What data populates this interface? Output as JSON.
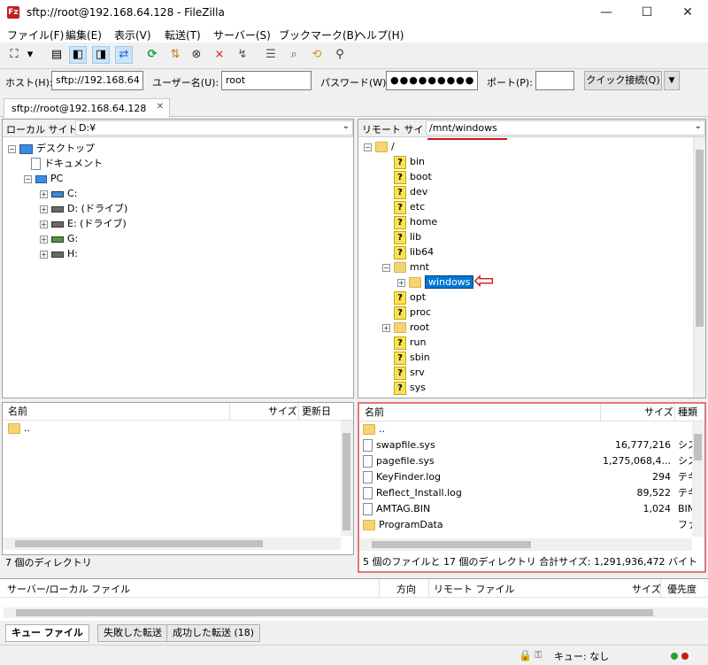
{
  "window": {
    "title": "sftp://root@192.168.64.128 - FileZilla",
    "app_icon": "Fz",
    "minimize": "—",
    "maximize": "☐",
    "close": "✕"
  },
  "menu": [
    "ファイル(F)",
    "編集(E)",
    "表示(V)",
    "転送(T)",
    "サーバー(S)",
    "ブックマーク(B)",
    "ヘルプ(H)"
  ],
  "toolbar_icons": [
    "site-manager-icon",
    "dropdown-icon",
    "message-log-icon",
    "local-tree-icon",
    "remote-tree-icon",
    "transfer-queue-icon",
    "refresh-icon",
    "process-queue-icon",
    "cancel-icon",
    "disconnect-icon",
    "reconnect-icon",
    "filter-icon",
    "compare-icon",
    "sync-browse-icon",
    "search-icon"
  ],
  "quickconnect": {
    "host_label": "ホスト(H):",
    "host": "sftp://192.168.64",
    "user_label": "ユーザー名(U):",
    "user": "root",
    "pass_label": "パスワード(W):",
    "pass": "●●●●●●●●●",
    "port_label": "ポート(P):",
    "port": "",
    "connect": "クイック接続(Q)",
    "dropdown": "▼"
  },
  "tab": {
    "label": "sftp://root@192.168.64.128",
    "close": "✕"
  },
  "local": {
    "site_label": "ローカル サイト:",
    "path": "D:¥",
    "tree": [
      {
        "label": "デスクトップ"
      },
      {
        "label": "ドキュメント"
      },
      {
        "label": "PC"
      },
      {
        "label": "C:"
      },
      {
        "label": "D: (ドライブ)"
      },
      {
        "label": "E: (ドライブ)"
      },
      {
        "label": "G:"
      },
      {
        "label": "H:"
      }
    ],
    "cols": {
      "name": "名前",
      "size": "サイズ",
      "modified": "更新日"
    },
    "files": [
      {
        "name": ".."
      }
    ],
    "status": "7 個のディレクトリ"
  },
  "remote": {
    "site_label": "リモート サイト:",
    "path": "/mnt/windows",
    "tree": [
      "/",
      "bin",
      "boot",
      "dev",
      "etc",
      "home",
      "lib",
      "lib64",
      "mnt",
      "windows",
      "opt",
      "proc",
      "root",
      "run",
      "sbin",
      "srv",
      "sys"
    ],
    "cols": {
      "name": "名前",
      "size": "サイズ",
      "type": "種類"
    },
    "files": [
      {
        "name": "..",
        "size": "",
        "type": ""
      },
      {
        "name": "swapfile.sys",
        "size": "16,777,216",
        "type": "シス"
      },
      {
        "name": "pagefile.sys",
        "size": "1,275,068,4...",
        "type": "シス"
      },
      {
        "name": "KeyFinder.log",
        "size": "294",
        "type": "テキ"
      },
      {
        "name": "Reflect_Install.log",
        "size": "89,522",
        "type": "テキ"
      },
      {
        "name": "AMTAG.BIN",
        "size": "1,024",
        "type": "BIN"
      },
      {
        "name": "ProgramData",
        "size": "",
        "type": "ファ"
      }
    ],
    "status": "5 個のファイルと 17 個のディレクトリ 合計サイズ: 1,291,936,472 バイト"
  },
  "queue": {
    "col1": "サーバー/ローカル ファイル",
    "col2": "方向",
    "col3": "リモート ファイル",
    "col4": "サイズ",
    "col5": "優先度"
  },
  "bottom_tabs": [
    "キュー ファイル",
    "失敗した転送",
    "成功した転送 (18)"
  ],
  "statusbar": {
    "queue": "キュー: なし"
  },
  "colors": {
    "highlight": "#d01414",
    "selection": "#0078d7"
  }
}
